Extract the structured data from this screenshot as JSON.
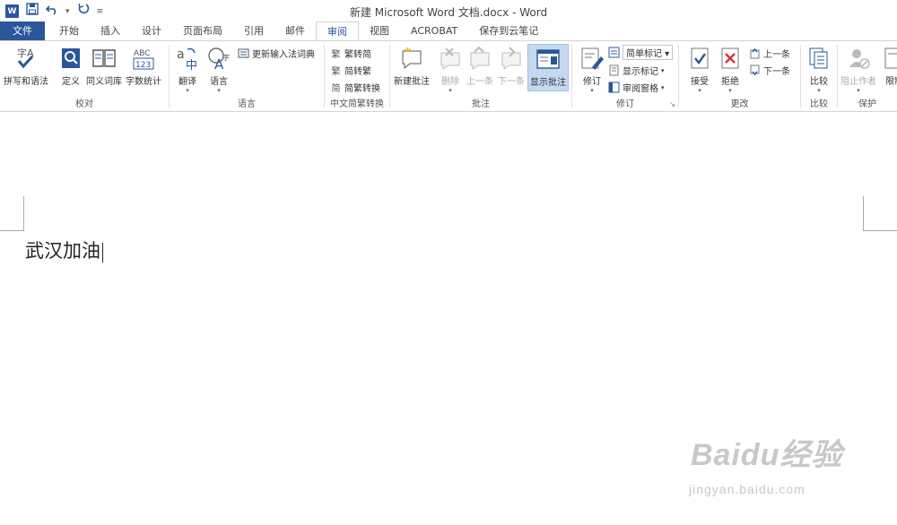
{
  "window": {
    "title": "新建 Microsoft Word 文档.docx - Word",
    "logo": "W"
  },
  "qat": {
    "icons": [
      "save-icon",
      "undo-icon",
      "redo-icon",
      "customize-icon"
    ]
  },
  "tabs": [
    "文件",
    "开始",
    "插入",
    "设计",
    "页面布局",
    "引用",
    "邮件",
    "审阅",
    "视图",
    "ACROBAT",
    "保存到云笔记"
  ],
  "active_tab": "审阅",
  "ribbon": {
    "proofing": {
      "label": "校对",
      "buttons": [
        "拼写和语法",
        "定义",
        "同义词库",
        "字数统计"
      ]
    },
    "language": {
      "label": "语言",
      "translate": "翻译",
      "language": "语言",
      "update_ime": "更新输入法词典"
    },
    "chinese": {
      "label": "中文简繁转换",
      "buttons": [
        "繁转简",
        "简转繁",
        "简繁转换"
      ]
    },
    "comments": {
      "label": "批注",
      "buttons": [
        "新建批注",
        "删除",
        "上一条",
        "下一条",
        "显示批注"
      ]
    },
    "tracking": {
      "label": "修订",
      "track_changes": "修订",
      "simple_markup": "简单标记",
      "show_markup": "显示标记",
      "review_pane": "审阅窗格"
    },
    "changes": {
      "label": "更改",
      "accept": "接受",
      "reject": "拒绝",
      "previous": "上一条",
      "next": "下一条"
    },
    "compare": {
      "label": "比较",
      "compare": "比较"
    },
    "protect": {
      "label": "保护",
      "block_authors": "阻止作者",
      "restrict": "限制"
    }
  },
  "document": {
    "text": "武汉加油"
  },
  "watermark": {
    "brand": "Baidu经验",
    "url": "jingyan.baidu.com"
  },
  "colors": {
    "accent": "#2b579a",
    "selected": "#c5d9f1"
  }
}
